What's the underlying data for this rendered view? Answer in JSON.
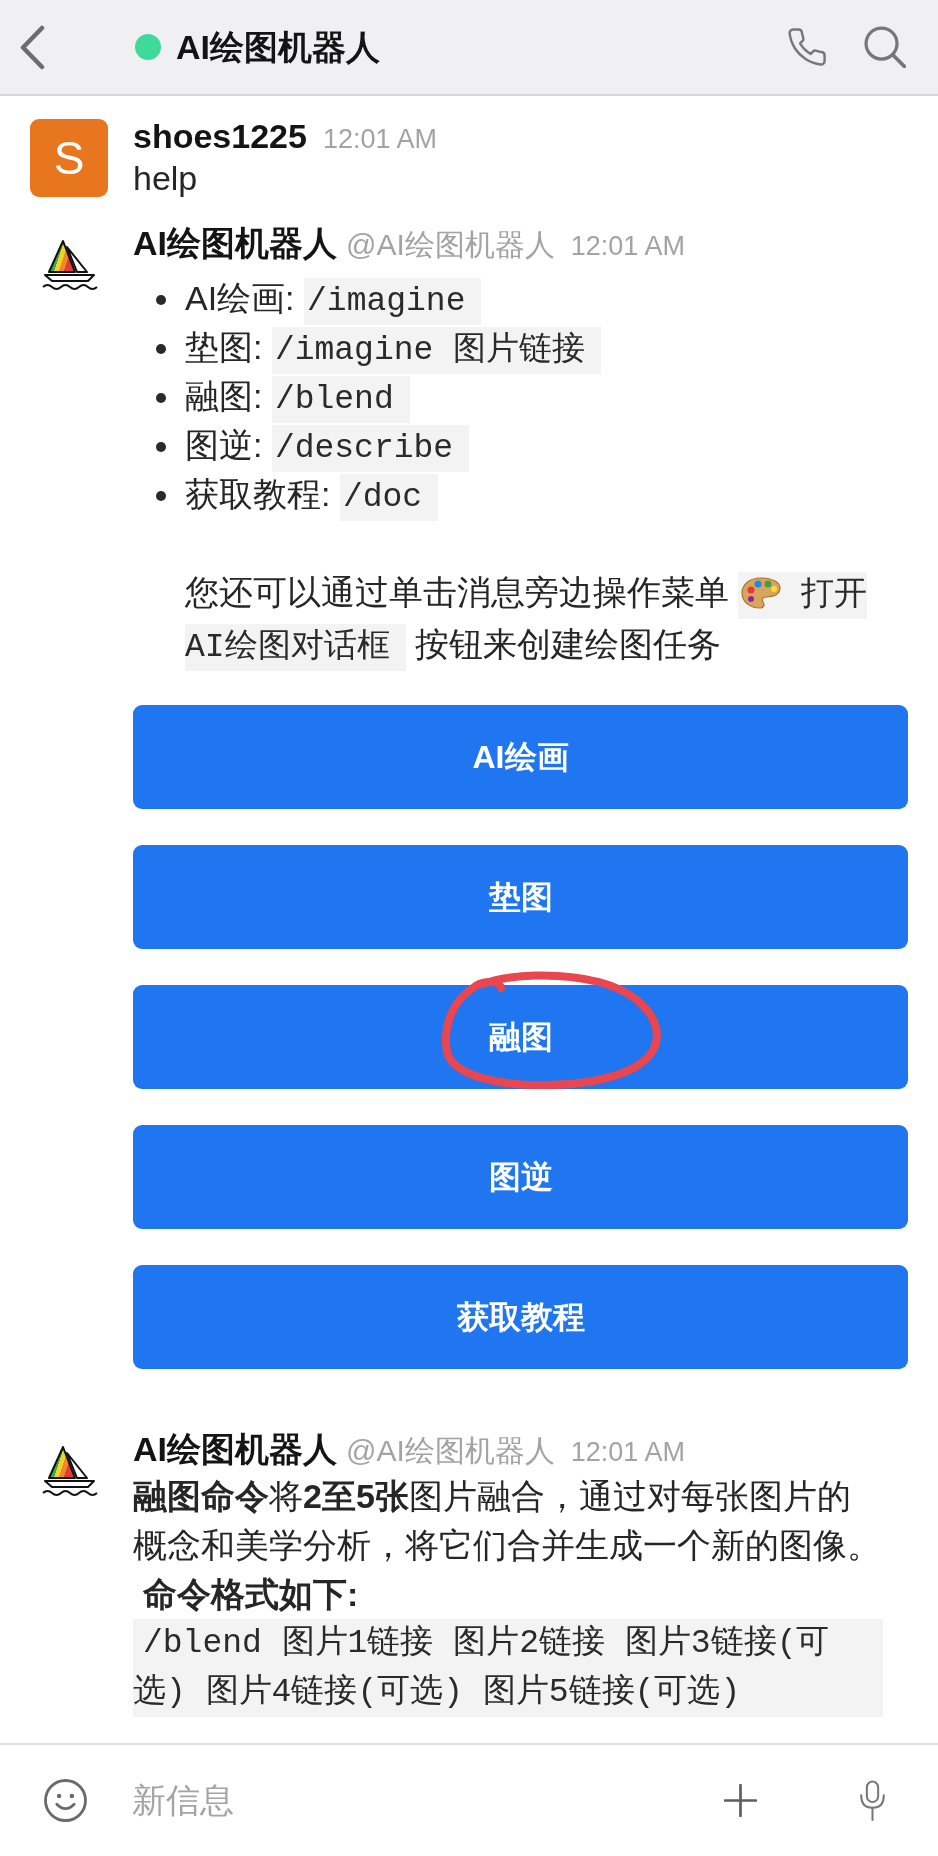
{
  "header": {
    "title": "AI绘图机器人",
    "online": true
  },
  "messages": [
    {
      "kind": "text",
      "avatar": {
        "kind": "letter",
        "letter": "S"
      },
      "author": "shoes1225",
      "time": "12:01 AM",
      "text": "help"
    },
    {
      "kind": "menu",
      "avatar": {
        "kind": "logo"
      },
      "author": "AI绘图机器人",
      "handle": "@AI绘图机器人",
      "time": "12:01 AM",
      "commands": [
        {
          "label": "AI绘画:",
          "code": "/imagine"
        },
        {
          "label": "垫图:",
          "code": "/imagine 图片链接"
        },
        {
          "label": "融图:",
          "code": "/blend"
        },
        {
          "label": "图逆:",
          "code": "/describe"
        },
        {
          "label": "获取教程:",
          "code": "/doc"
        }
      ],
      "note": {
        "before": "您还可以通过单击消息旁边操作菜单",
        "code": "打开 AI绘图对话框",
        "after": "按钮来创建绘图任务"
      },
      "buttons": [
        {
          "label": "AI绘画",
          "circled": false
        },
        {
          "label": "垫图",
          "circled": false
        },
        {
          "label": "融图",
          "circled": true
        },
        {
          "label": "图逆",
          "circled": false
        },
        {
          "label": "获取教程",
          "circled": false
        }
      ]
    },
    {
      "kind": "help",
      "avatar": {
        "kind": "logo"
      },
      "author": "AI绘图机器人",
      "handle": "@AI绘图机器人",
      "time": "12:01 AM",
      "text": "**融图命令**将**2至5张**图片融合，通过对每张图片的概念和美学分析，将它们合并生成一个新的图像。",
      "heading": "命令格式如下:",
      "code": "/blend 图片1链接 图片2链接 图片3链接(可选) 图片4链接(可选) 图片5链接(可选)"
    }
  ],
  "composer": {
    "placeholder": "新信息"
  }
}
